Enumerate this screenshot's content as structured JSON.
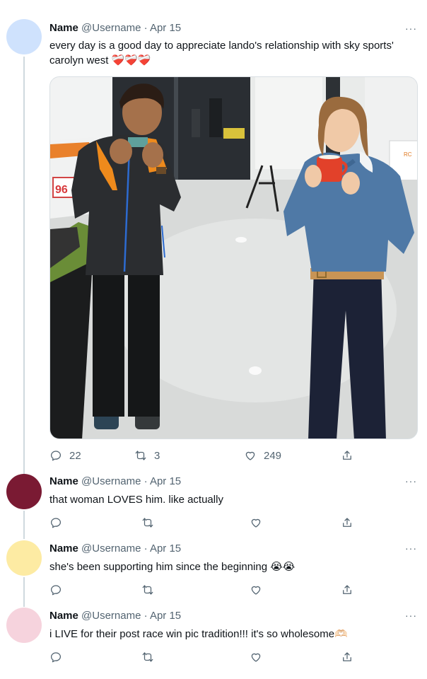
{
  "tweets": [
    {
      "name": "Name",
      "handle": "@Username",
      "date": "· Apr 15",
      "text": "every day is a good day to appreciate lando's relationship with sky sports' carolyn west ❤️‍🩹❤️‍🩹❤️‍🩹",
      "avatar_color": "#cfe2fd",
      "replies": "22",
      "retweets": "3",
      "likes": "249",
      "more": "···"
    },
    {
      "name": "Name",
      "handle": "@Username",
      "date": "· Apr 15",
      "text": "that woman LOVES him. like actually",
      "avatar_color": "#7a1a33",
      "more": "···"
    },
    {
      "name": "Name",
      "handle": "@Username",
      "date": "· Apr 15",
      "text": "she's been supporting him since the beginning 😭😭",
      "avatar_color": "#fdeba3",
      "more": "···"
    },
    {
      "name": "Name",
      "handle": "@Username",
      "date": "· Apr 15",
      "text": "i LIVE for their post race win pic tradition!!! it's so wholesome🫶🏻",
      "avatar_color": "#f6d3dd",
      "more": "···"
    }
  ],
  "media": {
    "car_number": "96"
  },
  "colors": {
    "text": "#0f1419",
    "muted": "#536471",
    "thread_line": "#cfd9de"
  }
}
